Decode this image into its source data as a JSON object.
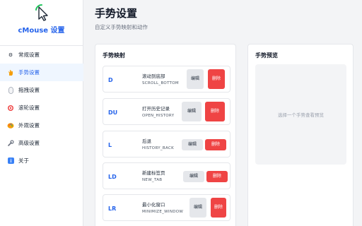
{
  "app": {
    "title": "cMouse 设置",
    "logo_icon": "mouse-cursor-logo-icon"
  },
  "sidebar": {
    "items": [
      {
        "label": "常规设置",
        "icon": "gear-icon"
      },
      {
        "label": "手势设置",
        "icon": "hand-icon",
        "active": true
      },
      {
        "label": "拖拽设置",
        "icon": "mouse-icon"
      },
      {
        "label": "滚轮设置",
        "icon": "target-icon"
      },
      {
        "label": "外观设置",
        "icon": "palette-icon"
      },
      {
        "label": "高级设置",
        "icon": "wrench-icon"
      },
      {
        "label": "关于",
        "icon": "info-icon"
      }
    ]
  },
  "header": {
    "title": "手势设置",
    "subtitle": "自定义手势映射和动作"
  },
  "mappings": {
    "title": "手势映射",
    "edit_label": "编辑",
    "delete_label": "删除",
    "items": [
      {
        "code": "D",
        "name": "滚动到底部",
        "action": "SCROLL_BOTTOM"
      },
      {
        "code": "DU",
        "name": "打开历史记录",
        "action": "OPEN_HISTORY"
      },
      {
        "code": "L",
        "name": "后退",
        "action": "HISTORY_BACK"
      },
      {
        "code": "LD",
        "name": "新建标签页",
        "action": "NEW_TAB"
      },
      {
        "code": "LR",
        "name": "最小化窗口",
        "action": "MINIMIZE_WINDOW"
      }
    ]
  },
  "preview": {
    "title": "手势预览",
    "placeholder": "选择一个手势查看预览"
  },
  "colors": {
    "accent": "#2563eb",
    "danger": "#ef4444",
    "active_bg": "#eff6ff"
  }
}
